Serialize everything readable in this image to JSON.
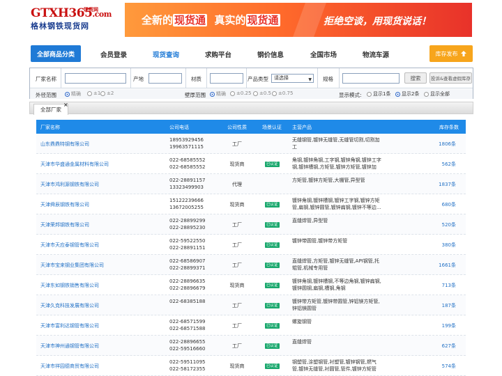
{
  "logo": {
    "main": "GTXH365",
    "com": ".com",
    "tag": "现货网",
    "subtitle": "格林钢铁现货网"
  },
  "banner": {
    "part1_pre": "全新的",
    "part1_hl": "现货通",
    "part2_pre": "真实的",
    "part2_hl": "现货通",
    "slogan": "拒绝空谈，用现货说话！"
  },
  "nav": {
    "all_label": "全部商品分类",
    "items": [
      "会员登录",
      "现货查询",
      "求购平台",
      "钢价信息",
      "全国市场",
      "物流车源"
    ],
    "active_index": 1,
    "release_label": "库存发布",
    "release_icon": "upload-icon"
  },
  "filter": {
    "factory_label": "厂家名称",
    "origin_label": "产地",
    "material_label": "材质",
    "category_label": "产品类型",
    "category_value": "请选择",
    "spec_label": "规格",
    "search_btn": "搜索",
    "view_btn": "投诉&查看虚假库存",
    "od_label": "外径范围",
    "od_options": [
      "精确",
      "±1",
      "±2"
    ],
    "wall_label": "壁厚范围",
    "wall_options": [
      "精确",
      "±0.25",
      "±0.5",
      "±0.75"
    ],
    "display_label": "显示模式:",
    "display_options": [
      "显示1条",
      "显示2条",
      "显示全部"
    ],
    "display_selected": 1
  },
  "tabs": {
    "active": "全部厂家",
    "close": "×"
  },
  "table": {
    "headers": [
      "厂家名称",
      "公司电话",
      "公司性质",
      "场景认证",
      "主营产品",
      "库存条数"
    ],
    "rows": [
      {
        "name": "山东鼎鼎特钢有限公司",
        "tel1": "18953929456",
        "tel2": "19963571115",
        "type": "工厂",
        "verified": "",
        "products": "无缝钢管,镀锌无缝管,无缝管切割,切割加工",
        "stock": "1806条"
      },
      {
        "name": "天津市华盛通金属材料有限公司",
        "tel1": "022-68585552",
        "tel2": "022-68585552",
        "type": "现货商",
        "verified": "已认证",
        "products": "角钢,镀锌角钢,工字钢,镀锌角钢,镀锌工字钢,镀锌槽钢,方矩管,镀锌方矩管,镀锌加工...",
        "stock": "562条"
      },
      {
        "name": "天津市鸿利源钢铁有限公司",
        "tel1": "022-28891157",
        "tel2": "13323499903",
        "type": "代理",
        "verified": "",
        "products": "方矩管,镀锌方矩管,大棚管,异型管",
        "stock": "1837条"
      },
      {
        "name": "天津舜辰钢铁有限公司",
        "tel1": "15122239666",
        "tel2": "13672005255",
        "type": "现货商",
        "verified": "已认证",
        "products": "镀锌角钢,镀锌槽钢,镀锌工字钢,镀锌方矩管,扁钢,镀锌圆管,镀锌扁钢,镀锌不等边...",
        "stock": "680条"
      },
      {
        "name": "天津荣邦钢铁有限公司",
        "tel1": "022-28899299",
        "tel2": "022-28895230",
        "type": "工厂",
        "verified": "已认证",
        "products": "直缝焊管,异型管",
        "stock": "520条"
      },
      {
        "name": "天津市天应泰钢管有限公司",
        "tel1": "022-59522550",
        "tel2": "022-28891151",
        "type": "工厂",
        "verified": "已认证",
        "products": "镀锌带圆管,镀锌带方矩管",
        "stock": "380条"
      },
      {
        "name": "天津市宝来钢业集团有限公司",
        "tel1": "022-68586907",
        "tel2": "022-28899371",
        "type": "工厂",
        "verified": "已认证",
        "products": "直缝焊管,方矩管,镀锌无缝管,API钢管,托辊管,机械专用管",
        "stock": "1661条"
      },
      {
        "name": "天津东如钢铁销售有限公司",
        "tel1": "022-28896635",
        "tel2": "022-28896679",
        "type": "现货商",
        "verified": "已认证",
        "products": "镀锌角钢,镀锌槽钢,不等边角钢,镀锌扁钢,镀锌圆钢,扁钢,槽钢,角钢",
        "stock": "713条"
      },
      {
        "name": "天津久克科技发展有限公司",
        "tel1": "022-68385188",
        "tel2": "",
        "type": "工厂",
        "verified": "已认证",
        "products": "镀锌带方矩管,镀锌带圆管,锌铝镁方矩管,锌铝镁圆管",
        "stock": "187条"
      },
      {
        "name": "天津市富利达钢管有限公司",
        "tel1": "022-68571599",
        "tel2": "022-68571588",
        "type": "工厂",
        "verified": "已认证",
        "products": "螺旋钢管",
        "stock": "199条"
      },
      {
        "name": "天津市神州通钢管有限公司",
        "tel1": "022-28896655",
        "tel2": "022-59516660",
        "type": "工厂",
        "verified": "已认证",
        "products": "直缝焊管",
        "stock": "627条"
      },
      {
        "name": "天津市祥园德商贸有限公司",
        "tel1": "022-59511095",
        "tel2": "022-58172355",
        "type": "现货商",
        "verified": "已认证",
        "products": "钢塑管,涂塑钢管,衬塑管,镀锌钢管,燃气管,镀锌无缝管,衬圆管,管件,镀锌方矩管",
        "stock": "574条"
      }
    ]
  },
  "colors": {
    "accent": "#1f7ad6",
    "header_blue": "#1f8ae8",
    "badge_green": "#19a86d",
    "release_orange": "#f7a51c",
    "logo_red": "#c91010"
  }
}
